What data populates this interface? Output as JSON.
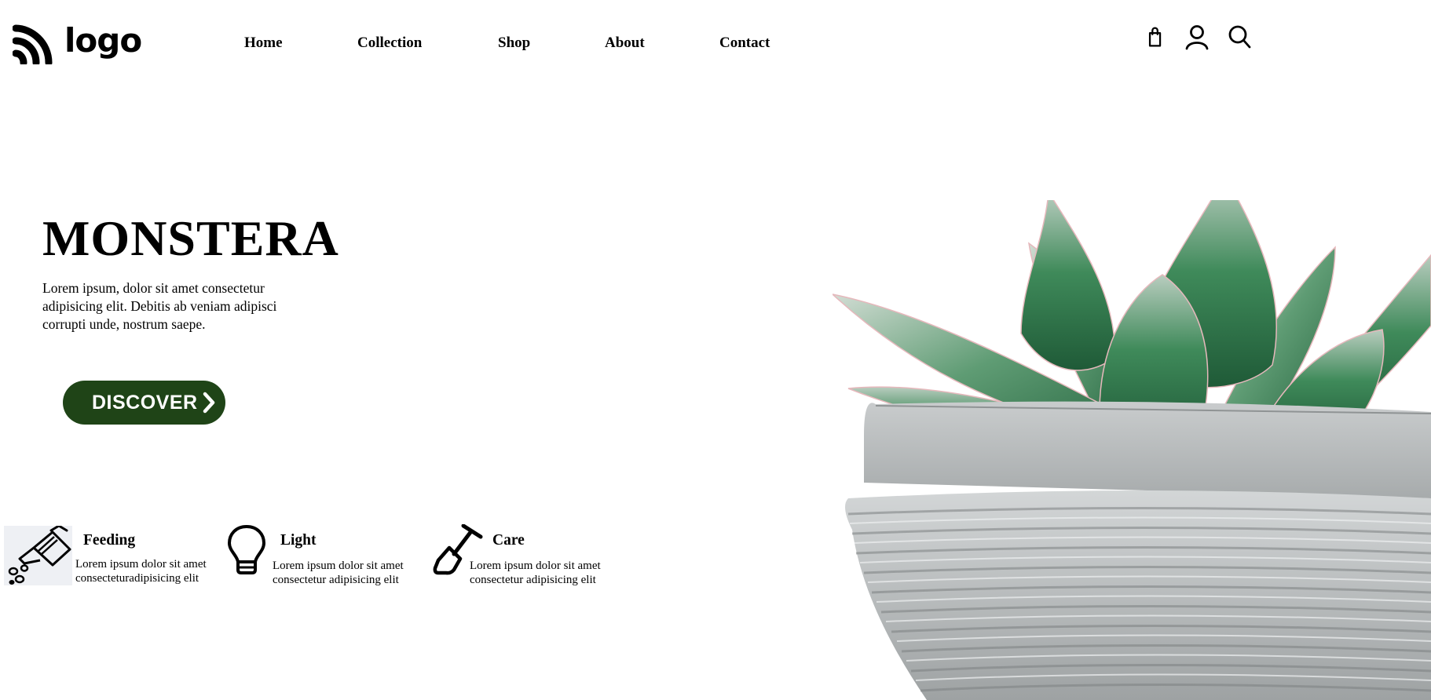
{
  "brand": {
    "logo_text": "logo"
  },
  "nav": {
    "items": [
      "Home",
      "Collection",
      "Shop",
      "About",
      "Contact"
    ]
  },
  "header_icons": [
    "shopping-bag-icon",
    "user-icon",
    "search-icon"
  ],
  "hero": {
    "title": "MONSTERA",
    "description": "Lorem ipsum, dolor sit amet consectetur adipisicing elit. Debitis ab veniam adipisci corrupti unde, nostrum saepe.",
    "cta_label": "DISCOVER"
  },
  "features": [
    {
      "title": "Feeding",
      "text": "Lorem ipsum dolor sit amet consecteturadipisicing elit",
      "icon": "watering-can-icon"
    },
    {
      "title": "Light",
      "text": "Lorem ipsum dolor sit amet consectetur adipisicing elit",
      "icon": "lightbulb-icon"
    },
    {
      "title": "Care",
      "text": "Lorem ipsum dolor sit amet consectetur adipisicing elit",
      "icon": "shovel-icon"
    }
  ],
  "colors": {
    "accent": "#1f4417",
    "background": "#ffffff",
    "text": "#000000"
  }
}
